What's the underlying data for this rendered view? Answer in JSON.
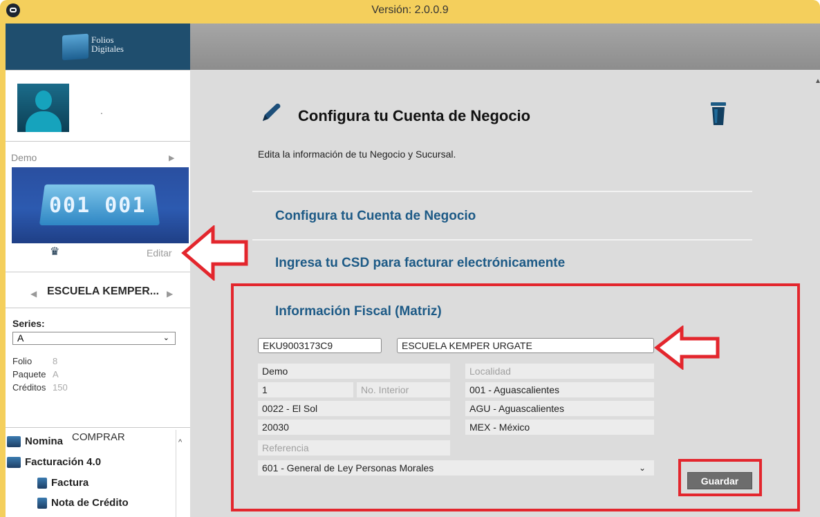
{
  "titlebar": {
    "version": "Versión: 2.0.0.9"
  },
  "logo": {
    "line1": "Folios",
    "line2": "Digitales"
  },
  "user": {
    "name": "."
  },
  "account": {
    "label": "Demo",
    "image_text": "001 001",
    "edit_label": "Editar"
  },
  "company": {
    "name": "ESCUELA KEMPER..."
  },
  "series": {
    "label": "Series:",
    "selected": "A",
    "info": [
      {
        "key": "Folio",
        "value": "8"
      },
      {
        "key": "Paquete",
        "value": "A"
      },
      {
        "key": "Créditos",
        "value": "150"
      }
    ],
    "buy_label": "COMPRAR"
  },
  "menu": {
    "items": [
      {
        "label": "Nomina"
      },
      {
        "label": "Facturación 4.0"
      },
      {
        "label": "Factura"
      },
      {
        "label": "Nota de Crédito"
      }
    ]
  },
  "main": {
    "title": "Configura tu Cuenta de Negocio",
    "subtitle": "Edita la información de tu Negocio y Sucursal.",
    "sections": [
      "Configura tu Cuenta de Negocio",
      "Ingresa tu CSD para facturar electrónicamente",
      "Información Fiscal (Matriz)"
    ]
  },
  "form": {
    "rfc": "EKU9003173C9",
    "razon_social": "ESCUELA KEMPER URGATE",
    "calle": "Demo",
    "localidad_placeholder": "Localidad",
    "no_exterior": "1",
    "no_interior_placeholder": "No. Interior",
    "municipio": "001 - Aguascalientes",
    "colonia": "0022 - El Sol",
    "estado": "AGU - Aguascalientes",
    "cp": "20030",
    "pais": "MEX - México",
    "referencia_placeholder": "Referencia",
    "regimen": "601 - General de Ley Personas Morales",
    "save_label": "Guardar"
  },
  "colors": {
    "titlebar": "#f4cf5c",
    "logo_bar": "#1f4e6e",
    "section_link": "#1d5a86",
    "highlight": "#e3262d",
    "main_bg": "#dcdcdc"
  }
}
